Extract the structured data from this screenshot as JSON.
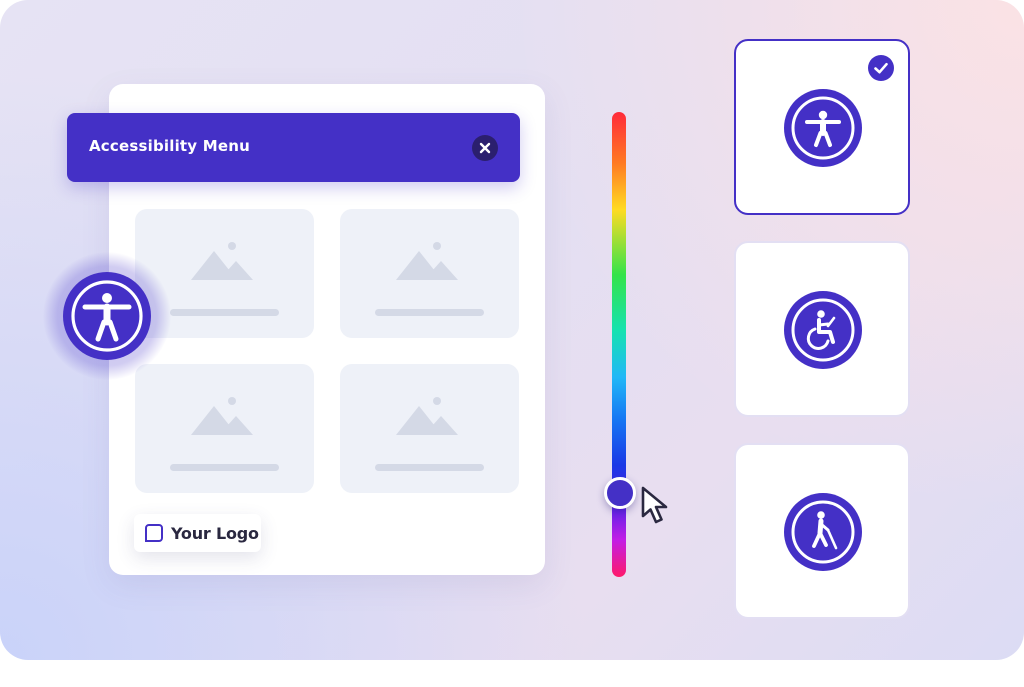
{
  "menu": {
    "title": "Accessibility Menu"
  },
  "logo": {
    "text": "Your Logo"
  },
  "slider": {
    "level": 0.82
  },
  "options": [
    {
      "icon": "accessibility-person-icon",
      "selected": true
    },
    {
      "icon": "wheelchair-laptop-icon",
      "selected": false
    },
    {
      "icon": "blind-cane-icon",
      "selected": false
    }
  ],
  "colors": {
    "primary": "#4430c6",
    "close_bg": "#2b1f6e",
    "placeholder_card": "#eef1f8",
    "placeholder_shape": "#d4d9e6"
  }
}
